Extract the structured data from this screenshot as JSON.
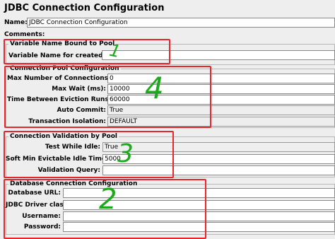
{
  "title": "JDBC Connection Configuration",
  "name": {
    "label": "Name:",
    "value": "JDBC Connection Configuration"
  },
  "comments": {
    "label": "Comments:"
  },
  "variable_section": {
    "title": "Variable Name Bound to Pool",
    "label": "Variable Name for created pool:",
    "value": ""
  },
  "pool_section": {
    "title": "Connection Pool Configuration",
    "fields": [
      {
        "label": "Max Number of Connections:",
        "value": "0"
      },
      {
        "label": "Max Wait (ms):",
        "value": "10000"
      },
      {
        "label": "Time Between Eviction Runs (ms):",
        "value": "60000"
      },
      {
        "label": "Auto Commit:",
        "value": "True"
      },
      {
        "label": "Transaction Isolation:",
        "value": "DEFAULT"
      }
    ]
  },
  "validation_section": {
    "title": "Connection Validation by Pool",
    "fields": [
      {
        "label": "Test While Idle:",
        "value": "True"
      },
      {
        "label": "Soft Min Evictable Idle Time(ms):",
        "value": "5000"
      },
      {
        "label": "Validation Query:",
        "value": ""
      }
    ]
  },
  "database_section": {
    "title": "Database Connection Configuration",
    "fields": [
      {
        "label": "Database URL:",
        "value": ""
      },
      {
        "label": "JDBC Driver class:",
        "value": ""
      },
      {
        "label": "Username:",
        "value": ""
      },
      {
        "label": "Password:",
        "value": ""
      }
    ]
  },
  "annotations": {
    "one": "1",
    "two": "2",
    "three": "3",
    "four": "4"
  },
  "colors": {
    "annotation_box": "#e8262b",
    "handwriting": "#1aaa1a",
    "background": "#eeeeee"
  }
}
